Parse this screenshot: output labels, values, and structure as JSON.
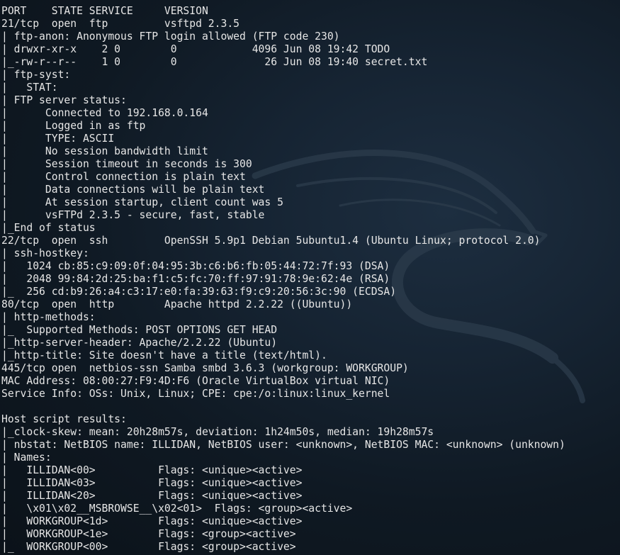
{
  "terminal": {
    "lines": [
      "PORT    STATE SERVICE     VERSION",
      "21/tcp  open  ftp         vsftpd 2.3.5",
      "| ftp-anon: Anonymous FTP login allowed (FTP code 230)",
      "| drwxr-xr-x    2 0        0            4096 Jun 08 19:42 TODO",
      "|_-rw-r--r--    1 0        0              26 Jun 08 19:40 secret.txt",
      "| ftp-syst:",
      "|   STAT:",
      "| FTP server status:",
      "|      Connected to 192.168.0.164",
      "|      Logged in as ftp",
      "|      TYPE: ASCII",
      "|      No session bandwidth limit",
      "|      Session timeout in seconds is 300",
      "|      Control connection is plain text",
      "|      Data connections will be plain text",
      "|      At session startup, client count was 5",
      "|      vsFTPd 2.3.5 - secure, fast, stable",
      "|_End of status",
      "22/tcp  open  ssh         OpenSSH 5.9p1 Debian 5ubuntu1.4 (Ubuntu Linux; protocol 2.0)",
      "| ssh-hostkey:",
      "|   1024 cb:85:c9:09:0f:04:95:3b:c6:b6:fb:05:44:72:7f:93 (DSA)",
      "|   2048 99:84:2d:25:ba:f1:c5:fc:70:ff:97:91:78:9e:62:4e (RSA)",
      "|_  256 cd:b9:26:a4:c3:17:e0:fa:39:63:f9:c9:20:56:3c:90 (ECDSA)",
      "80/tcp  open  http        Apache httpd 2.2.22 ((Ubuntu))",
      "| http-methods:",
      "|_  Supported Methods: POST OPTIONS GET HEAD",
      "|_http-server-header: Apache/2.2.22 (Ubuntu)",
      "|_http-title: Site doesn't have a title (text/html).",
      "445/tcp open  netbios-ssn Samba smbd 3.6.3 (workgroup: WORKGROUP)",
      "MAC Address: 08:00:27:F9:4D:F6 (Oracle VirtualBox virtual NIC)",
      "Service Info: OSs: Unix, Linux; CPE: cpe:/o:linux:linux_kernel",
      "",
      "Host script results:",
      "|_clock-skew: mean: 20h28m57s, deviation: 1h24m50s, median: 19h28m57s",
      "| nbstat: NetBIOS name: ILLIDAN, NetBIOS user: <unknown>, NetBIOS MAC: <unknown> (unknown)",
      "| Names:",
      "|   ILLIDAN<00>          Flags: <unique><active>",
      "|   ILLIDAN<03>          Flags: <unique><active>",
      "|   ILLIDAN<20>          Flags: <unique><active>",
      "|   \\x01\\x02__MSBROWSE__\\x02<01>  Flags: <group><active>",
      "|   WORKGROUP<1d>        Flags: <unique><active>",
      "|   WORKGROUP<1e>        Flags: <group><active>",
      "|_  WORKGROUP<00>        Flags: <group><active>"
    ]
  },
  "theme": {
    "background": "#162433",
    "text_color": "#e6e6e6",
    "watermark": "kali-dragon-watermark"
  }
}
